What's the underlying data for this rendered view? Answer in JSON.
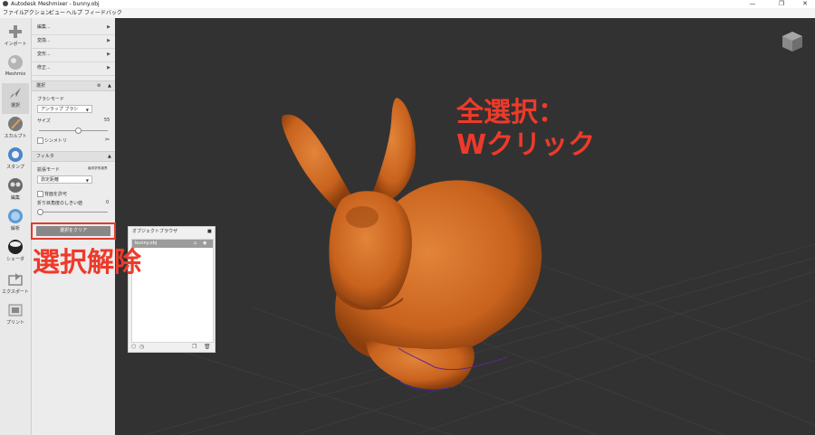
{
  "window": {
    "title": "Autodesk Meshmixer - bunny.obj",
    "minimize": "—",
    "restore": "❐",
    "close": "✕"
  },
  "menu": [
    "ファイル",
    "アクション",
    "ビュー",
    "ヘルプ",
    "フィードバック"
  ],
  "toolbar": [
    {
      "label": "インポート",
      "icon": "plus-icon"
    },
    {
      "label": "Meshmix",
      "icon": "meshmix-sphere-icon"
    },
    {
      "label": "選択",
      "icon": "select-arrow-icon"
    },
    {
      "label": "スカルプト",
      "icon": "brush-icon"
    },
    {
      "label": "スタンプ",
      "icon": "stamp-icon"
    },
    {
      "label": "編集",
      "icon": "edit-icon"
    },
    {
      "label": "解析",
      "icon": "analysis-icon"
    },
    {
      "label": "シェーダ",
      "icon": "shader-icon"
    },
    {
      "label": "エクスポート",
      "icon": "export-icon"
    },
    {
      "label": "プリント",
      "icon": "print-icon"
    }
  ],
  "panel": {
    "menu_items": [
      "編集...",
      "変換...",
      "変形...",
      "修正..."
    ],
    "select_section": {
      "title": "選択",
      "brush_mode_label": "ブラシモード",
      "brush_mode_value": "アンラップ ブラシ",
      "size_label": "サイズ",
      "size_value": "55",
      "symmetry_label": "シンメトリ"
    },
    "filter_section": {
      "title": "フィルタ",
      "expand_mode_label": "拡張モード",
      "expand_mode_extra": "幾何学的境界",
      "expand_mode_value": "測定距離",
      "allow_back_label": "背面を許可",
      "crease_label": "折り目角度のしきい値",
      "crease_value": "0"
    },
    "clear_button": "選択をクリア"
  },
  "object_browser": {
    "title": "オブジェクトブラウザ",
    "items": [
      {
        "name": "bunny.obj"
      }
    ]
  },
  "annotations": {
    "select_all_line1": "全選択：",
    "select_all_line2": "Wクリック",
    "deselect": "選択解除",
    "color": "#ee3a2a"
  },
  "colors": {
    "model": "#c8621d",
    "viewport": "#323232",
    "panel": "#ececec"
  }
}
